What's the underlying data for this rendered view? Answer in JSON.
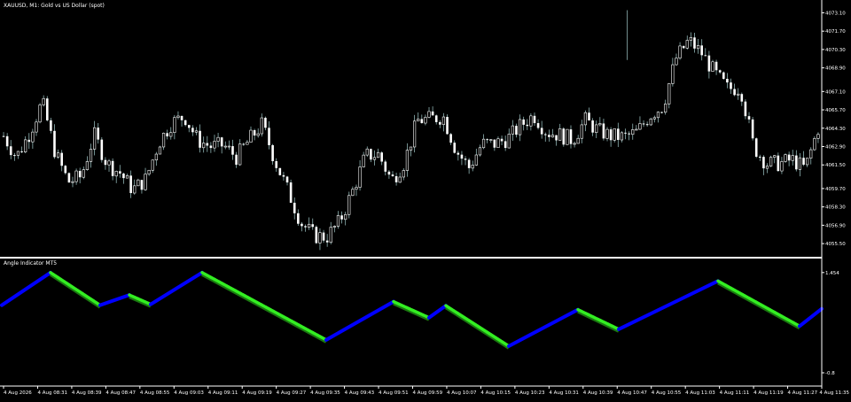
{
  "window": {
    "symbol_title": "XAUUSD, M1:  Gold vs US Dollar (spot)",
    "indicator_title": "Angle Indicator MT5"
  },
  "colors": {
    "background": "#000000",
    "axis": "#ffffff",
    "separator": "#ffffff",
    "candle_up": "#ffffff",
    "candle_down": "#ffffff",
    "wick": "#8fb3b3",
    "indicator_up": "#0000ff",
    "indicator_down": "#33ee22",
    "indicator_down_shadow": "#1a7a10"
  },
  "chart_data": [
    {
      "type": "candlestick",
      "title": "XAUUSD, M1:  Gold vs US Dollar (spot)",
      "y_ticks": [
        "4073.10",
        "4071.70",
        "4070.30",
        "4068.90",
        "4067.10",
        "4065.70",
        "4064.30",
        "4062.90",
        "4061.50",
        "4059.70",
        "4058.30",
        "4056.90",
        "4055.50"
      ],
      "ylim": [
        4054.9,
        4073.4
      ],
      "close_path": [
        4063.7,
        4062.1,
        4063.9,
        4066.3,
        4062.4,
        4060.2,
        4060.6,
        4063.8,
        4061.6,
        4060.9,
        4059.6,
        4060.4,
        4063.2,
        4064.7,
        4065.2,
        4063.4,
        4062.9,
        4063.0,
        4062.1,
        4063.4,
        4064.6,
        4061.8,
        4059.5,
        4057.1,
        4056.1,
        4056.0,
        4057.2,
        4059.5,
        4062.2,
        4062.3,
        4060.3,
        4061.7,
        4064.9,
        4065.0,
        4065.2,
        4062.6,
        4061.3,
        4063.1,
        4063.1,
        4063.5,
        4064.5,
        4065.3,
        4064.0,
        4063.8,
        4063.4,
        4064.9,
        4064.1,
        4063.7,
        4063.6,
        4064.0,
        4065.3,
        4066.0,
        4069.6,
        4071.0,
        4070.0,
        4068.5,
        4067.3,
        4067.4,
        4062.9,
        4061.6,
        4061.6,
        4061.9,
        4061.2,
        4064.3
      ]
    },
    {
      "type": "line",
      "title": "Angle Indicator MT5",
      "y_ticks": [
        "1.454",
        "-0.8"
      ],
      "ylim": [
        -0.86,
        1.49
      ],
      "series": [
        {
          "values": [
            0.72,
            1.454,
            0.72,
            0.95,
            0.74,
            1.454,
            -0.06,
            0.8,
            0.44,
            0.71,
            -0.2,
            0.62,
            0.18,
            1.264,
            0.25,
            0.64
          ]
        }
      ]
    }
  ],
  "x_axis": {
    "labels": [
      "4 Aug 2026",
      "4 Aug 08:31",
      "4 Aug 08:39",
      "4 Aug 08:47",
      "4 Aug 08:55",
      "4 Aug 09:03",
      "4 Aug 09:11",
      "4 Aug 09:19",
      "4 Aug 09:27",
      "4 Aug 09:35",
      "4 Aug 09:43",
      "4 Aug 09:51",
      "4 Aug 09:59",
      "4 Aug 10:07",
      "4 Aug 10:15",
      "4 Aug 10:23",
      "4 Aug 10:31",
      "4 Aug 10:39",
      "4 Aug 10:47",
      "4 Aug 10:55",
      "4 Aug 11:03",
      "4 Aug 11:11",
      "4 Aug 11:19",
      "4 Aug 11:27",
      "4 Aug 11:35"
    ]
  }
}
